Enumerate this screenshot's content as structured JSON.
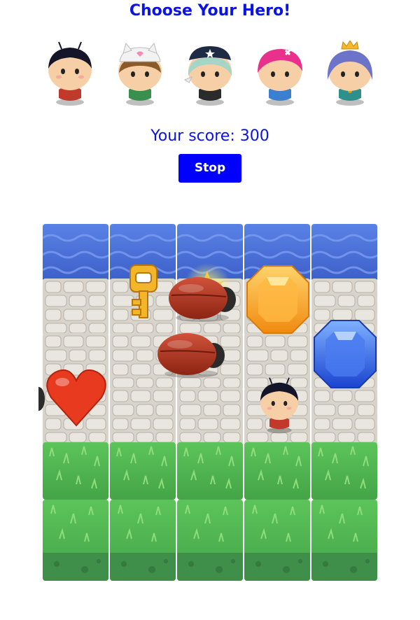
{
  "header": {
    "title": "Choose Your Hero!"
  },
  "heroes": [
    {
      "name": "boy-hero",
      "hair": "#1a1a2e",
      "shirt": "#c0392b",
      "accessory": "antennae"
    },
    {
      "name": "cat-hero",
      "hair": "#8b5a2b",
      "shirt": "#3a8f4f",
      "accessory": "cat-hat"
    },
    {
      "name": "pirate-hero",
      "hair": "#a6d4c6",
      "shirt": "#2b2b2b",
      "accessory": "pirate-hat"
    },
    {
      "name": "pink-hero",
      "hair": "#e8308c",
      "shirt": "#3a7fd0",
      "accessory": "bow"
    },
    {
      "name": "princess-hero",
      "hair": "#6b74c8",
      "shirt": "#2f8f8a",
      "accessory": "crown"
    }
  ],
  "status": {
    "score_text": "Your score: 300"
  },
  "controls": {
    "stop_label": "Stop"
  },
  "colors": {
    "accent": "#0a14e6",
    "button": "#0000ff",
    "water": "#4a6fd8",
    "stone": "#d8d4cc",
    "grass": "#4fb54a"
  },
  "board": {
    "columns": 5,
    "rows": [
      "water",
      "stone",
      "stone",
      "stone",
      "grass",
      "grass"
    ],
    "items": [
      "key-icon",
      "red-beetle",
      "red-beetle",
      "orange-gem",
      "blue-gem",
      "heart-icon",
      "player-hero",
      "star-icon"
    ]
  }
}
